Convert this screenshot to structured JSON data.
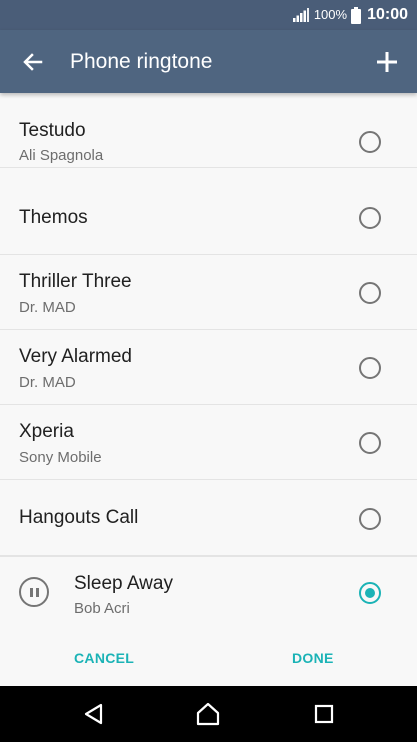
{
  "status_bar": {
    "battery_percent": "100%",
    "time": "10:00",
    "signal_icon": "signal-icon",
    "battery_icon": "battery-icon"
  },
  "toolbar": {
    "title": "Phone ringtone",
    "back_icon": "back-arrow-icon",
    "add_icon": "plus-icon"
  },
  "ringtones": [
    {
      "title": "Testudo",
      "subtitle": "Ali Spagnola",
      "selected": false
    },
    {
      "title": "Themos",
      "subtitle": "",
      "selected": false
    },
    {
      "title": "Thriller Three",
      "subtitle": "Dr. MAD",
      "selected": false
    },
    {
      "title": "Very Alarmed",
      "subtitle": "Dr. MAD",
      "selected": false
    },
    {
      "title": "Xperia",
      "subtitle": "Sony Mobile",
      "selected": false
    },
    {
      "title": "Hangouts Call",
      "subtitle": "",
      "selected": false
    }
  ],
  "selected_ringtone": {
    "title": "Sleep Away",
    "subtitle": "Bob Acri",
    "selected": true,
    "playback_icon": "pause-icon"
  },
  "actions": {
    "cancel_label": "CANCEL",
    "done_label": "DONE"
  },
  "colors": {
    "status_bar": "#4a5d78",
    "toolbar": "#4f6580",
    "accent": "#1bb3b6",
    "background": "#f8f8f8",
    "navbar": "#000000"
  },
  "nav_bar": {
    "back_icon": "nav-back-icon",
    "home_icon": "nav-home-icon",
    "recents_icon": "nav-recents-icon"
  }
}
